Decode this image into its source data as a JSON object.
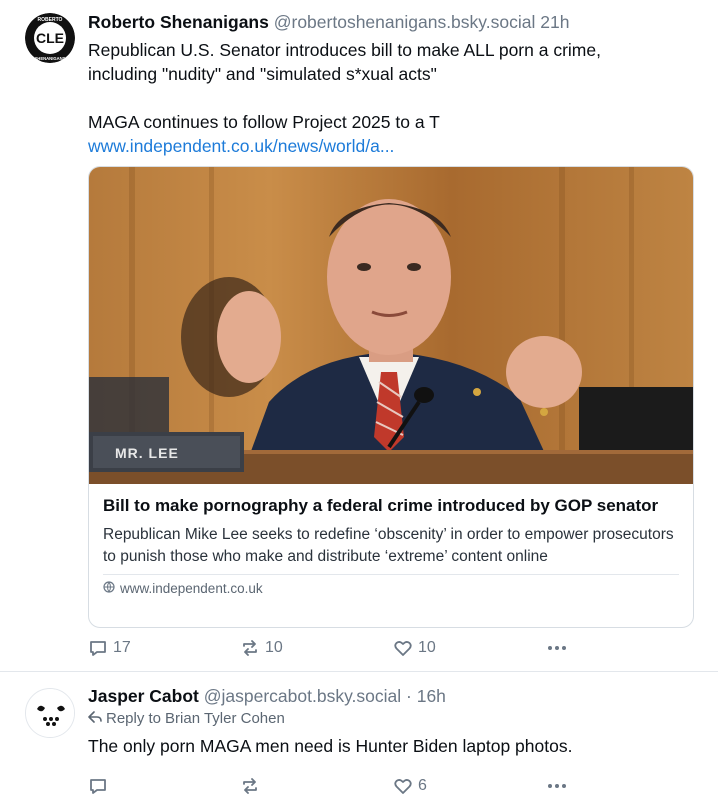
{
  "posts": [
    {
      "author_name": "Roberto Shenanigans",
      "handle": "@robertoshenanigans.bsky.social",
      "time": "21h",
      "avatar_text": "CLE",
      "avatar_ring_text_top": "ROBERTO",
      "avatar_ring_text_bottom": "SHENANIGANS",
      "text_line1": "Republican U.S. Senator introduces bill to make ALL porn a crime,",
      "text_line2": "including \"nudity\" and \"simulated s*xual acts\"",
      "text_line3": "MAGA continues to follow Project 2025 to a T",
      "link_text": "www.independent.co.uk/news/world/a...",
      "card": {
        "nameplate": "MR. LEE",
        "title": "Bill to make pornography a federal crime introduced by GOP senator",
        "description": "Republican Mike Lee seeks to redefine ‘obscenity’ in order to empower prosecutors to punish those who make and distribute ‘extreme’ content online",
        "domain": "www.independent.co.uk"
      },
      "actions": {
        "replies": "17",
        "reposts": "10",
        "likes": "10"
      }
    },
    {
      "author_name": "Jasper Cabot",
      "handle": "@jaspercabot.bsky.social",
      "separator": "·",
      "time": "16h",
      "reply_to_label": "Reply to",
      "reply_to_name": "Brian Tyler Cohen",
      "text": "The only porn MAGA men need is Hunter Biden laptop photos.",
      "actions": {
        "likes": "6"
      }
    }
  ],
  "colors": {
    "link": "#1d7bd9",
    "muted": "#6b7785",
    "text": "#0b0f14",
    "border": "#d7dde3"
  },
  "icons": [
    "reply-icon",
    "repost-icon",
    "like-icon",
    "more-icon",
    "globe-icon",
    "reply-arrow-icon"
  ]
}
